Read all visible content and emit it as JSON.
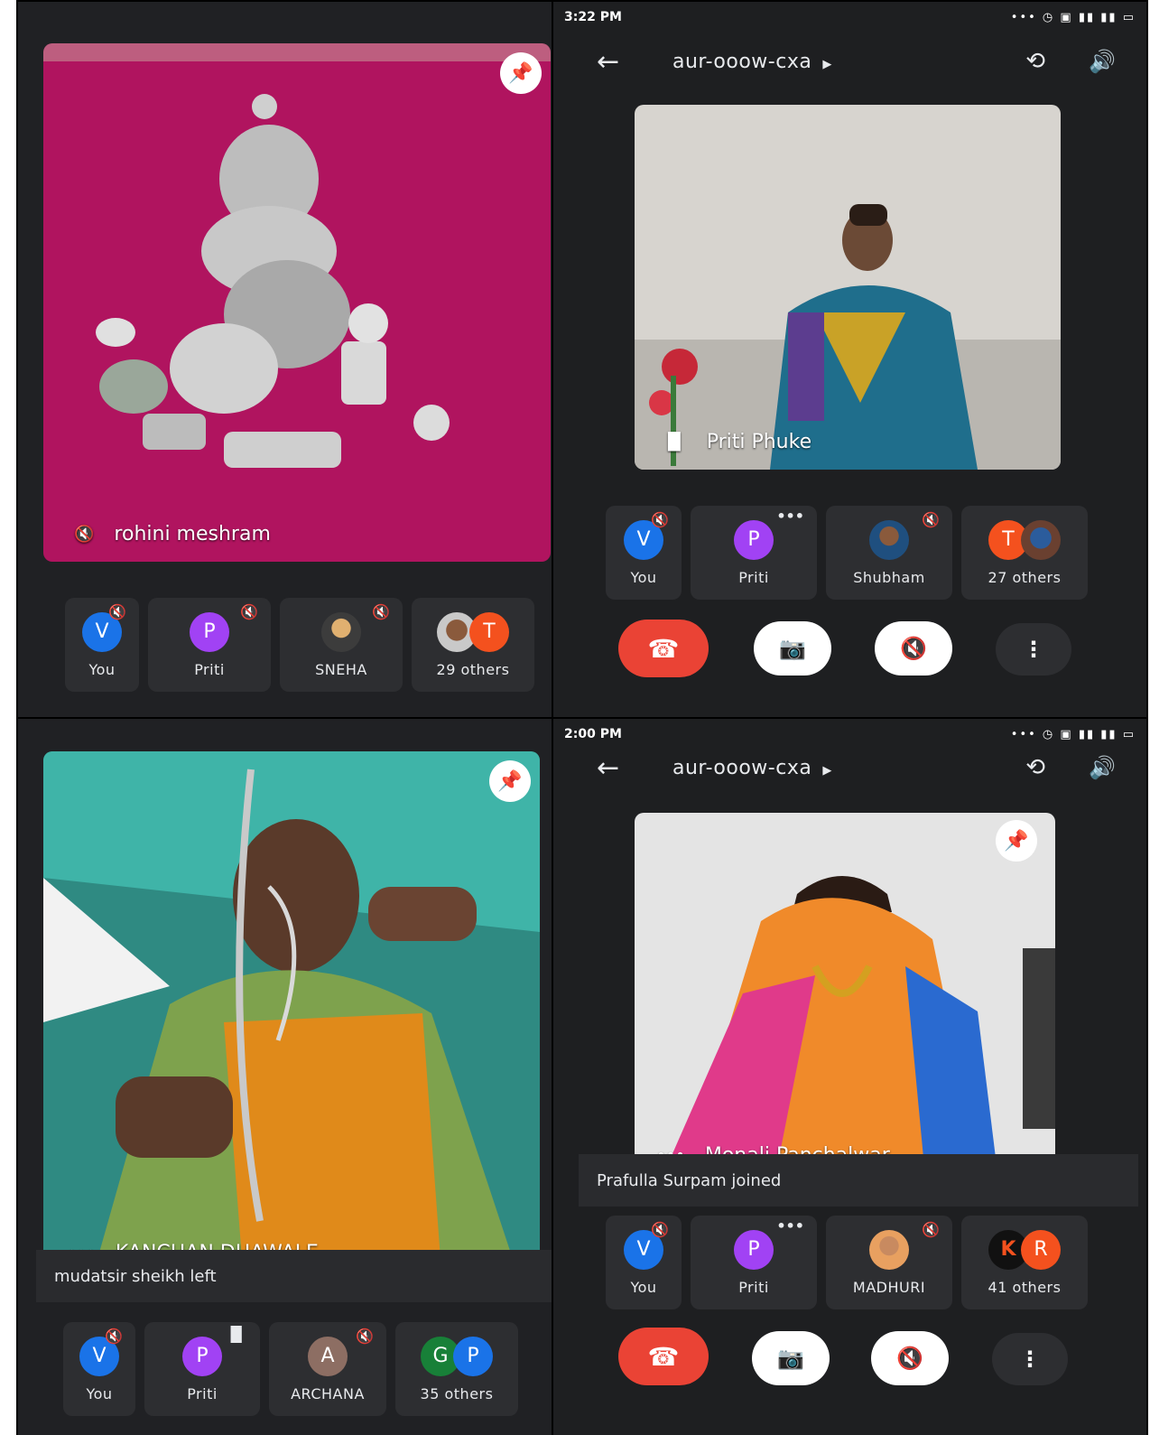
{
  "panels": {
    "top_left": {
      "main_tile": {
        "name": "rohini meshram"
      },
      "participants": [
        {
          "initial": "V",
          "label": "You",
          "color": "#1a73e8",
          "badge": "mute"
        },
        {
          "initial": "P",
          "label": "Priti",
          "color": "#a142f4",
          "badge": "mute"
        },
        {
          "initial": "",
          "label": "SNEHA",
          "color": "#3c3c3c",
          "badge": "mute"
        },
        {
          "initial": "T",
          "label": "29 others",
          "color": "#f4511e",
          "badge": ""
        }
      ]
    },
    "top_right": {
      "status_time": "3:22 PM",
      "meeting_code": "aur-ooow-cxa",
      "main_tile": {
        "name": "Priti Phuke"
      },
      "participants": [
        {
          "initial": "V",
          "label": "You",
          "color": "#1a73e8",
          "badge": "mute"
        },
        {
          "initial": "P",
          "label": "Priti",
          "color": "#a142f4",
          "badge": "more"
        },
        {
          "initial": "",
          "label": "Shubham",
          "color": "#3c3c3c",
          "badge": "mute"
        },
        {
          "initial": "T",
          "label": "27 others",
          "color": "#f4511e",
          "badge": ""
        }
      ]
    },
    "bottom_left": {
      "main_tile": {
        "name": "KANCHAN DHAWALE"
      },
      "toast": "mudatsir sheikh left",
      "participants": [
        {
          "initial": "V",
          "label": "You",
          "color": "#1a73e8",
          "badge": "mute"
        },
        {
          "initial": "P",
          "label": "Priti",
          "color": "#a142f4",
          "badge": "speaking"
        },
        {
          "initial": "A",
          "label": "ARCHANA",
          "color": "#8d6e63",
          "badge": "mute"
        },
        {
          "initial": "G",
          "initial2": "P",
          "label": "35 others",
          "color": "#188038",
          "color2": "#1a73e8",
          "badge": ""
        }
      ]
    },
    "bottom_right": {
      "status_time": "2:00 PM",
      "meeting_code": "aur-ooow-cxa",
      "main_tile": {
        "name": "Monali Panchalwar"
      },
      "toast": "Prafulla Surpam joined",
      "participants": [
        {
          "initial": "V",
          "label": "You",
          "color": "#1a73e8",
          "badge": "mute"
        },
        {
          "initial": "P",
          "label": "Priti",
          "color": "#a142f4",
          "badge": "more"
        },
        {
          "initial": "",
          "label": "MADHURI",
          "color": "#3c3c3c",
          "badge": "mute"
        },
        {
          "initial": "K",
          "initial2": "R",
          "label": "41 others",
          "color": "#111111",
          "color2": "#f4511e",
          "badge": ""
        }
      ]
    }
  }
}
